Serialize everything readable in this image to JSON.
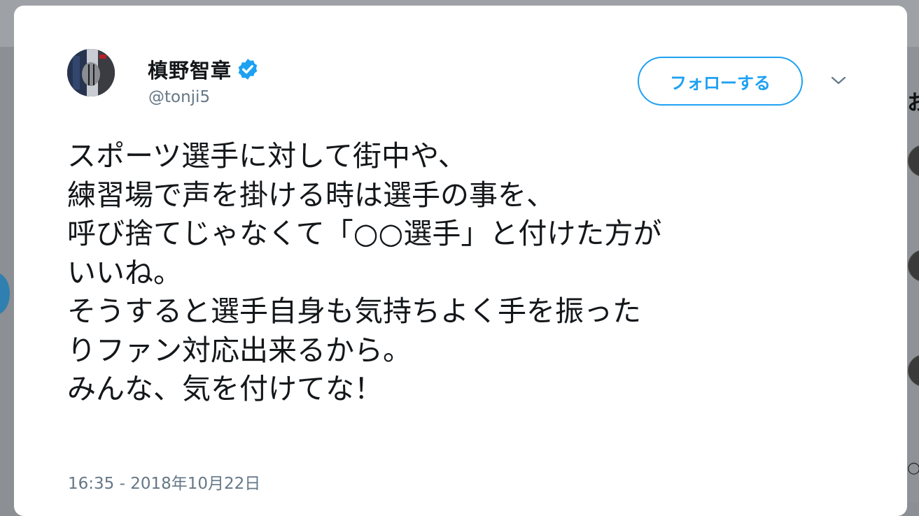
{
  "tweet": {
    "author": {
      "display_name": "槙野智章",
      "handle": "@tonji5",
      "verified": true,
      "avatar_icon": "profile-photo"
    },
    "follow_label": "フォローする",
    "menu_icon": "chevron-down-icon",
    "text_lines": [
      "スポーツ選手に対して街中や、",
      "練習場で声を掛ける時は選手の事を、",
      "呼び捨てじゃなくて「○○選手」と付けた方が",
      "いいね。",
      "そうすると選手自身も気持ちよく手を振った",
      "りファン対応出来るから。",
      "みんな、気を付けてな！"
    ],
    "timestamp": "16:35 - 2018年10月22日"
  },
  "colors": {
    "accent": "#1da1f2",
    "text": "#14171a",
    "secondary_text": "#657786",
    "backdrop": "#8c8f93"
  }
}
